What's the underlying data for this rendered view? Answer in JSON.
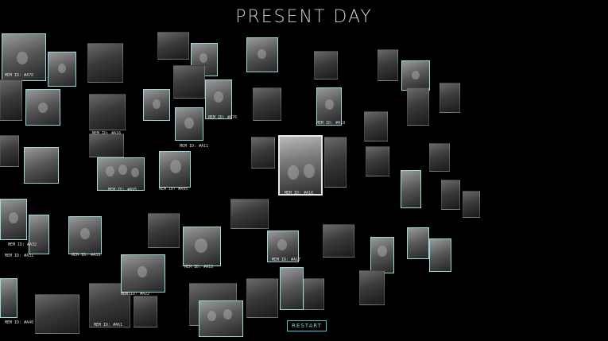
{
  "header": {
    "title": "PRESENT DAY"
  },
  "memory_labels": [
    "MEM ID: #A76",
    "MEM ID: #A16",
    "MEM ID: #A11",
    "MEM ID: #A76",
    "MEM ID: #A19",
    "MEM ID: #A95",
    "MEM ID: #A95",
    "MEM ID: #A16",
    "MEM ID: #A31",
    "MEM ID: #A32",
    "MEM ID: #A40",
    "MEM ID: #A18",
    "MEM ID: #A22",
    "MEM ID: #A61",
    "MEM ID: #A17",
    "MEM ID: #A33"
  ],
  "footer": {
    "restart_label": "RESTART"
  },
  "colors": {
    "accent": "#6fd2d6",
    "background": "#000000"
  }
}
